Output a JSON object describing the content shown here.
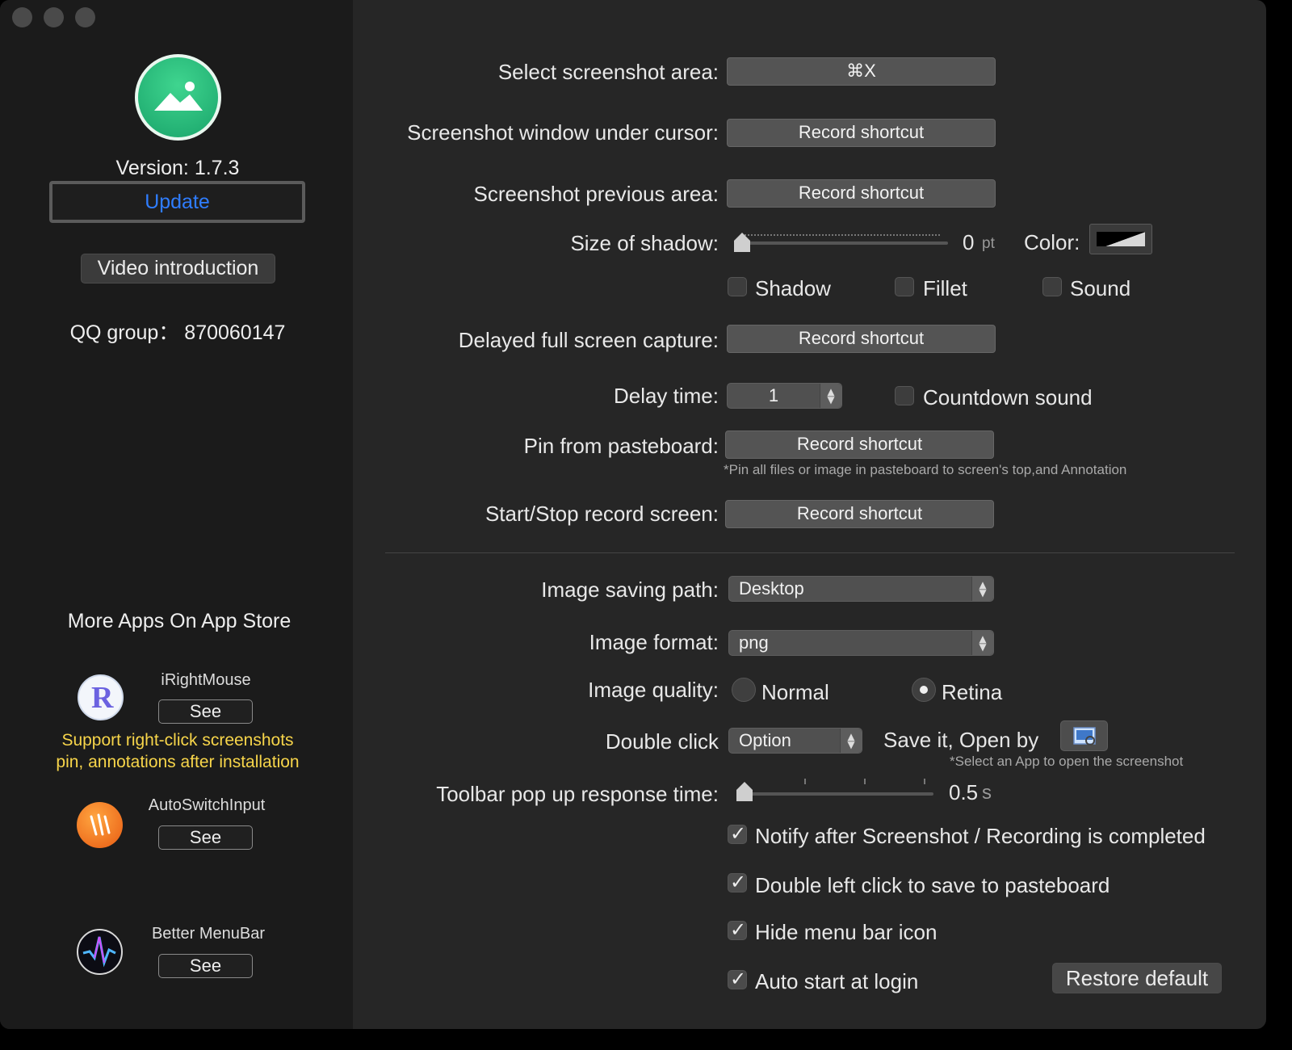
{
  "sidebar": {
    "version": "Version: 1.7.3",
    "update_label": "Update",
    "video_label": "Video introduction",
    "qq_group": "QQ group：  870060147",
    "more_apps_title": "More Apps On App Store",
    "apps": [
      {
        "name": "iRightMouse",
        "see": "See",
        "icon": "iright-mouse-icon"
      },
      {
        "name": "AutoSwitchInput",
        "see": "See",
        "icon": "autoswitchinput-icon"
      },
      {
        "name": "Better MenuBar",
        "see": "See",
        "icon": "better-menubar-icon"
      }
    ],
    "promo_line1": "Support right-click screenshots",
    "promo_line2": "pin, annotations after installation"
  },
  "settings": {
    "select_area_label": "Select screenshot area:",
    "select_area_value": "⌘X",
    "window_under_cursor_label": "Screenshot window under cursor:",
    "previous_area_label": "Screenshot previous area:",
    "record_shortcut": "Record shortcut",
    "shadow_size_label": "Size of shadow:",
    "shadow_value": "0",
    "shadow_unit": "pt",
    "shadow_level": 0,
    "color_label": "Color:",
    "shadow_cb": "Shadow",
    "fillet_cb": "Fillet",
    "sound_cb": "Sound",
    "delayed_label": "Delayed full screen capture:",
    "delay_time_label": "Delay time:",
    "delay_time_value": "1",
    "countdown_label": "Countdown sound",
    "pin_label": "Pin from pasteboard:",
    "pin_note": "*Pin all files or image in pasteboard to screen's top,and Annotation",
    "record_screen_label": "Start/Stop record screen:",
    "saving_path_label": "Image saving path:",
    "saving_path_value": "Desktop",
    "format_label": "Image format:",
    "format_value": "png",
    "quality_label": "Image quality:",
    "quality_normal": "Normal",
    "quality_retina": "Retina",
    "quality_selected": "Retina",
    "double_click_label": "Double click",
    "double_click_value": "Option",
    "save_open_label": "Save it, Open by",
    "open_note": "*Select an App to open the screenshot",
    "toolbar_label": "Toolbar pop up response time:",
    "toolbar_value": "0.5",
    "toolbar_unit": "s",
    "toolbar_level": 0,
    "notify_label": "Notify after Screenshot / Recording is completed",
    "double_left_label": "Double left click to save to pasteboard",
    "hide_icon_label": "Hide menu bar icon",
    "auto_start_label": "Auto start at login",
    "restore_label": "Restore default"
  },
  "colors": {
    "accent_blue": "#2f7dff",
    "promo_yellow": "#f7d54a",
    "app_green": "#22b574"
  }
}
